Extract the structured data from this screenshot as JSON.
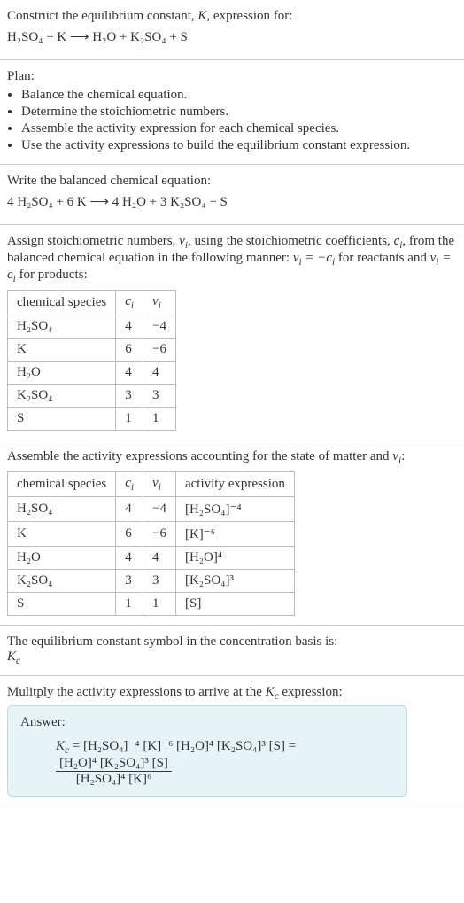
{
  "intro": {
    "line1_a": "Construct the equilibrium constant, ",
    "line1_b": ", expression for:",
    "equation": "H₂SO₄ + K ⟶ H₂O + K₂SO₄ + S"
  },
  "plan": {
    "title": "Plan:",
    "items": [
      "Balance the chemical equation.",
      "Determine the stoichiometric numbers.",
      "Assemble the activity expression for each chemical species.",
      "Use the activity expressions to build the equilibrium constant expression."
    ]
  },
  "balanced": {
    "title": "Write the balanced chemical equation:",
    "equation": "4 H₂SO₄ + 6 K ⟶ 4 H₂O + 3 K₂SO₄ + S"
  },
  "stoich": {
    "para_a": "Assign stoichiometric numbers, ",
    "para_b": ", using the stoichiometric coefficients, ",
    "para_c": ", from the balanced chemical equation in the following manner: ",
    "para_d": " for reactants and ",
    "para_e": " for products:",
    "headers": {
      "h1": "chemical species",
      "h2": "cᵢ",
      "h3": "νᵢ"
    },
    "rows": [
      {
        "s": "H₂SO₄",
        "c": "4",
        "n": "−4"
      },
      {
        "s": "K",
        "c": "6",
        "n": "−6"
      },
      {
        "s": "H₂O",
        "c": "4",
        "n": "4"
      },
      {
        "s": "K₂SO₄",
        "c": "3",
        "n": "3"
      },
      {
        "s": "S",
        "c": "1",
        "n": "1"
      }
    ]
  },
  "activity": {
    "para_a": "Assemble the activity expressions accounting for the state of matter and ",
    "para_b": ":",
    "headers": {
      "h1": "chemical species",
      "h2": "cᵢ",
      "h3": "νᵢ",
      "h4": "activity expression"
    },
    "rows": [
      {
        "s": "H₂SO₄",
        "c": "4",
        "n": "−4",
        "a": "[H₂SO₄]⁻⁴"
      },
      {
        "s": "K",
        "c": "6",
        "n": "−6",
        "a": "[K]⁻⁶"
      },
      {
        "s": "H₂O",
        "c": "4",
        "n": "4",
        "a": "[H₂O]⁴"
      },
      {
        "s": "K₂SO₄",
        "c": "3",
        "n": "3",
        "a": "[K₂SO₄]³"
      },
      {
        "s": "S",
        "c": "1",
        "n": "1",
        "a": "[S]"
      }
    ]
  },
  "symbol": {
    "line": "The equilibrium constant symbol in the concentration basis is:"
  },
  "mult": {
    "title_a": "Mulitply the activity expressions to arrive at the ",
    "title_b": " expression:"
  },
  "answer": {
    "label": "Answer:",
    "lhs": "Kc = [H₂SO₄]⁻⁴ [K]⁻⁶ [H₂O]⁴ [K₂SO₄]³ [S] = ",
    "num": "[H₂O]⁴ [K₂SO₄]³ [S]",
    "den": "[H₂SO₄]⁴ [K]⁶"
  },
  "chart_data": {
    "type": "table",
    "tables": [
      {
        "title": "Stoichiometric numbers",
        "columns": [
          "chemical species",
          "c_i",
          "nu_i"
        ],
        "rows": [
          [
            "H2SO4",
            4,
            -4
          ],
          [
            "K",
            6,
            -6
          ],
          [
            "H2O",
            4,
            4
          ],
          [
            "K2SO4",
            3,
            3
          ],
          [
            "S",
            1,
            1
          ]
        ]
      },
      {
        "title": "Activity expressions",
        "columns": [
          "chemical species",
          "c_i",
          "nu_i",
          "activity expression"
        ],
        "rows": [
          [
            "H2SO4",
            4,
            -4,
            "[H2SO4]^-4"
          ],
          [
            "K",
            6,
            -6,
            "[K]^-6"
          ],
          [
            "H2O",
            4,
            4,
            "[H2O]^4"
          ],
          [
            "K2SO4",
            3,
            3,
            "[K2SO4]^3"
          ],
          [
            "S",
            1,
            1,
            "[S]"
          ]
        ]
      }
    ]
  }
}
